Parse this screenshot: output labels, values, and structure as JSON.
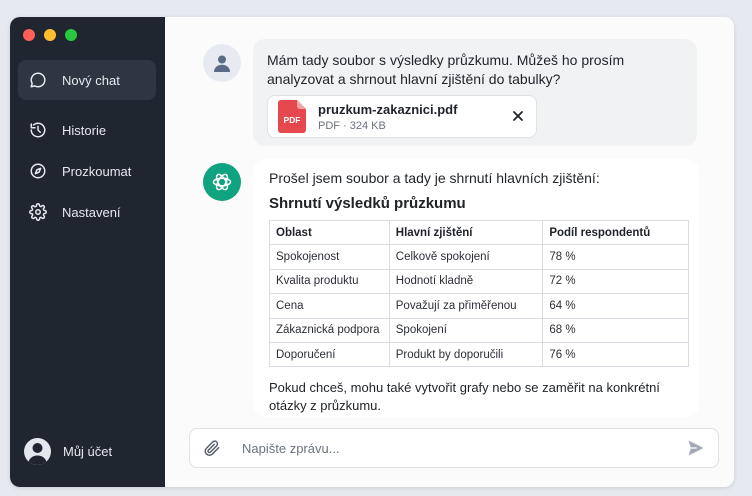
{
  "window": {
    "traffic_colors": [
      "#ff5f57",
      "#febc2e",
      "#28c840"
    ]
  },
  "sidebar": {
    "items": [
      {
        "label": "Nový chat",
        "icon": "chat-bubble-icon",
        "active": true
      },
      {
        "label": "Historie",
        "icon": "history-icon"
      },
      {
        "label": "Prozkoumat",
        "icon": "compass-icon"
      },
      {
        "label": "Nastavení",
        "icon": "gear-icon"
      }
    ],
    "account_label": "Můj účet"
  },
  "conversation": {
    "user_message": "Mám tady soubor s výsledky průzkumu. Můžeš ho prosím analyzovat a shrnout hlavní zjištění do tabulky?",
    "attachment": {
      "name": "pruzkum-zakaznici.pdf",
      "meta": "PDF · 324 KB",
      "badge": "PDF"
    },
    "assistant": {
      "intro": "Prošel jsem soubor a tady je shrnutí hlavních zjištění:",
      "title": "Shrnutí výsledků průzkumu",
      "table": {
        "headers": [
          "Oblast",
          "Hlavní zjištění",
          "Podíl respondentů"
        ],
        "rows": [
          [
            "Spokojenost",
            "Celkově spokojení",
            "78 %"
          ],
          [
            "Kvalita produktu",
            "Hodnotí kladně",
            "72 %"
          ],
          [
            "Cena",
            "Považují za přiměřenou",
            "64 %"
          ],
          [
            "Zákaznická podpora",
            "Spokojení",
            "68 %"
          ],
          [
            "Doporučení",
            "Produkt by doporučili",
            "76 %"
          ]
        ]
      },
      "outro": "Pokud chceš, mohu také vytvořit grafy nebo se zaměřit na konkrétní otázky z průzkumu."
    }
  },
  "composer": {
    "placeholder": "Napište zprávu..."
  },
  "colors": {
    "sidebar_bg": "#1f2630",
    "accent": "#10a37f",
    "pdf_red": "#e5484d"
  }
}
